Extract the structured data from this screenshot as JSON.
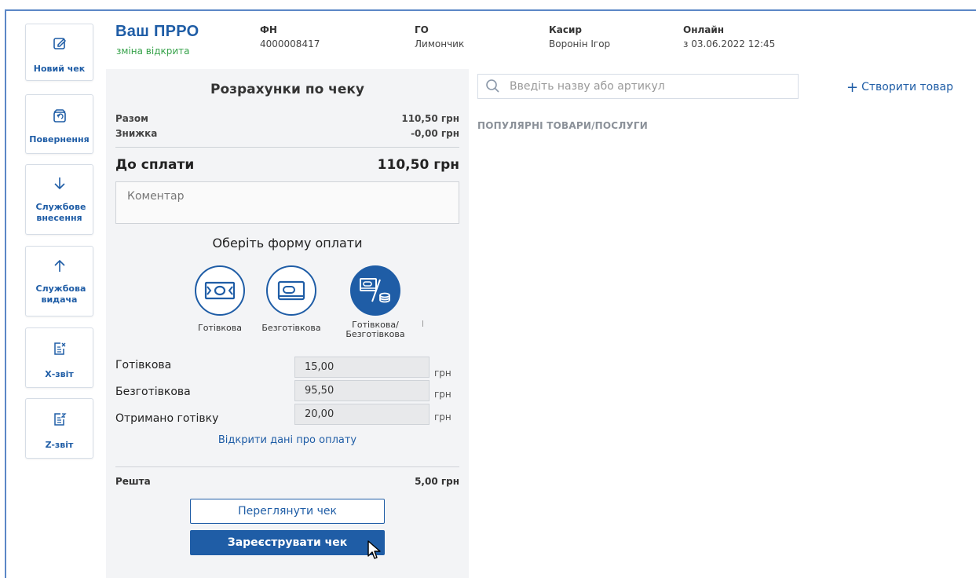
{
  "sidebar": {
    "items": [
      {
        "label": "Новий чек",
        "icon": "edit-icon"
      },
      {
        "label": "Повернення",
        "icon": "return-icon"
      },
      {
        "label": "Службове внесення",
        "icon": "arrow-down-icon"
      },
      {
        "label": "Службова видача",
        "icon": "arrow-up-icon"
      },
      {
        "label": "Х-звіт",
        "icon": "x-report-icon"
      },
      {
        "label": "Z-звіт",
        "icon": "z-report-icon"
      }
    ]
  },
  "header": {
    "brand": "Ваш ПРРО",
    "shift_status": "зміна відкрита",
    "fn_label": "ФН",
    "fn_value": "4000008417",
    "go_label": "ГО",
    "go_value": "Лимончик",
    "cashier_label": "Касир",
    "cashier_value": "Воронін Ігор",
    "online_label": "Онлайн",
    "online_value": "з 03.06.2022 12:45"
  },
  "receipt": {
    "title": "Розрахунки по чеку",
    "total_label": "Разом",
    "total_value": "110,50 грн",
    "discount_label": "Знижка",
    "discount_value": "-0,00 грн",
    "due_label": "До сплати",
    "due_value": "110,50 грн",
    "comment_placeholder": "Коментар",
    "payment_title": "Оберіть форму оплати",
    "payment_options": [
      {
        "label": "Готівкова",
        "selected": false
      },
      {
        "label": "Безготівкова",
        "selected": false
      },
      {
        "label": "Готівкова/ Безготівкова",
        "line1": "Готівкова/",
        "line2": "Безготівкова",
        "selected": true
      }
    ],
    "fields": [
      {
        "label": "Готівкова",
        "value": "15,00",
        "unit": "грн"
      },
      {
        "label": "Безготівкова",
        "value": "95,50",
        "unit": "грн"
      },
      {
        "label": "Отримано готівку",
        "value": "20,00",
        "unit": "грн"
      }
    ],
    "open_payment_link": "Відкрити дані про оплату",
    "change_label": "Решта",
    "change_value": "5,00 грн",
    "view_button": "Переглянути чек",
    "register_button": "Зареєструвати чек"
  },
  "products": {
    "search_placeholder": "Введіть назву або артикул",
    "create_button": "Створити товар",
    "popular_heading": "ПОПУЛЯРНІ ТОВАРИ/ПОСЛУГИ"
  },
  "colors": {
    "accent": "#1f5da6",
    "status_green": "#36a24a",
    "panel_bg": "#f3f4f6"
  }
}
